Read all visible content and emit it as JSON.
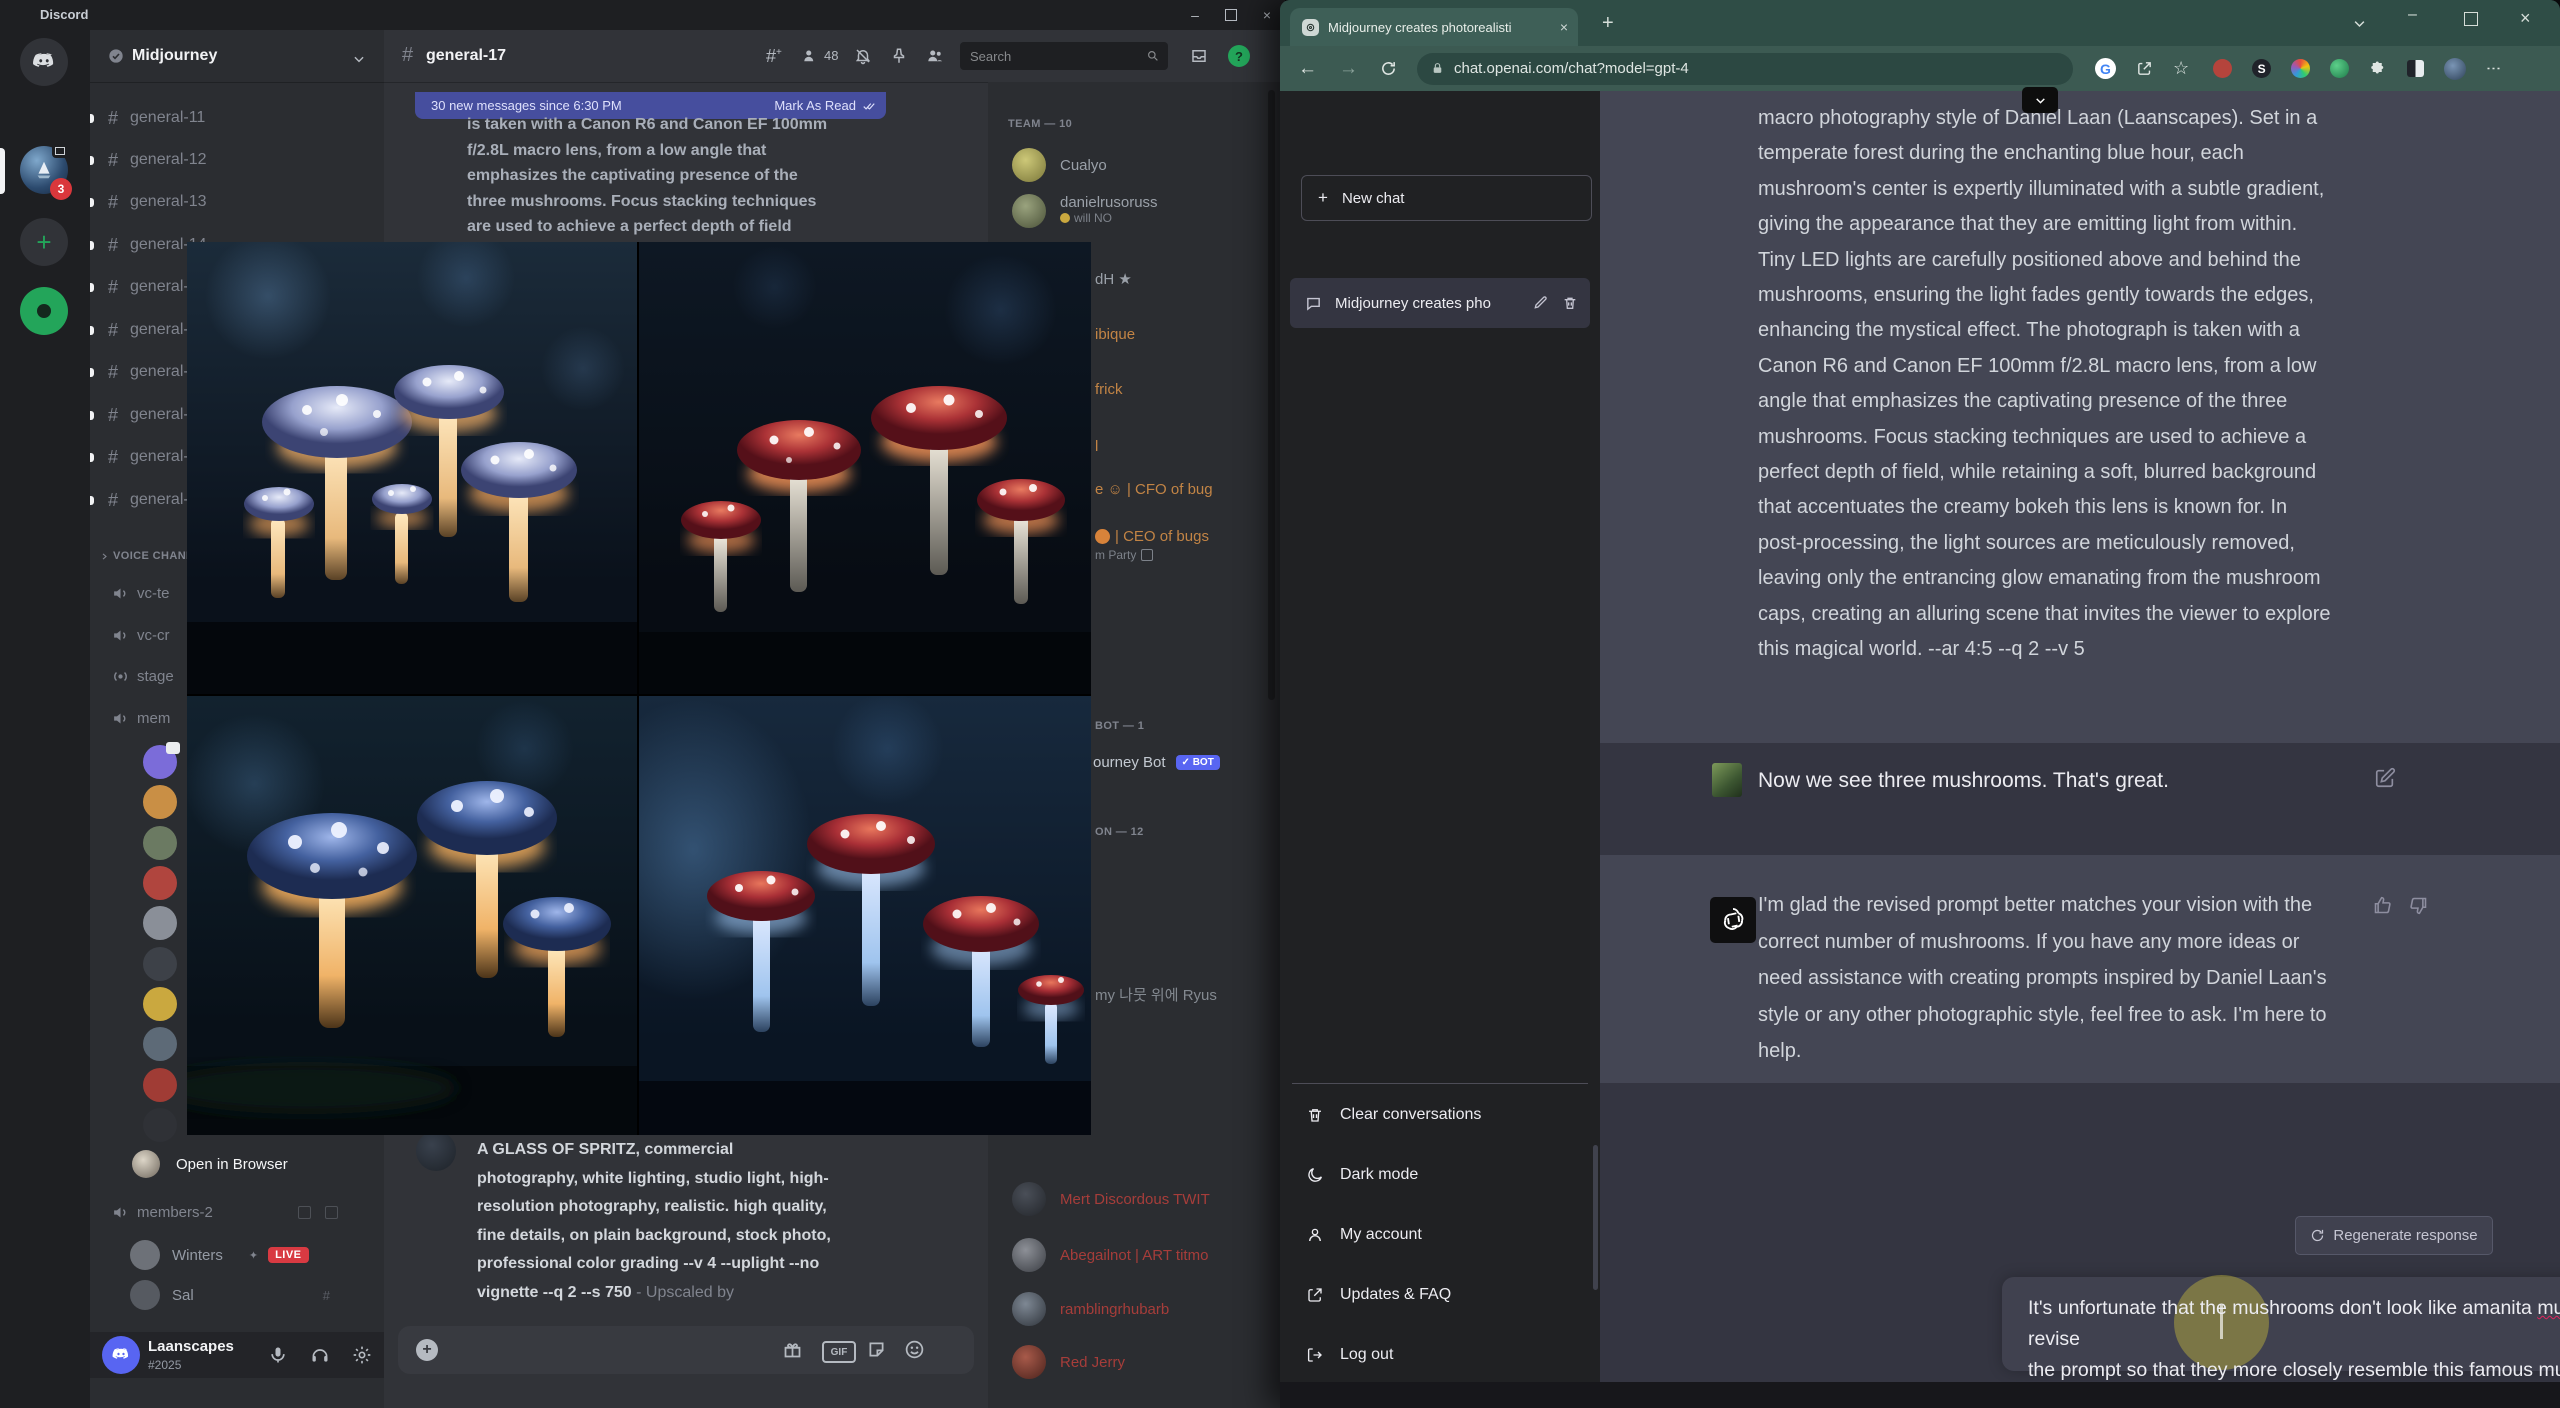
{
  "discord": {
    "title": "Discord",
    "server": "Midjourney",
    "channels": [
      "general-11",
      "general-12",
      "general-13",
      "general-14",
      "general-15",
      "general-16",
      "general-17",
      "general-18",
      "general-19",
      "general-20"
    ],
    "voice_category": "VOICE CHANNELS",
    "voice_channels": [
      "vc-te",
      "vc-cr",
      "stage",
      "mem"
    ],
    "open_in_browser": "Open in Browser",
    "members2": "members-2",
    "winters": "Winters",
    "live_badge": "LIVE",
    "sal": "Sal",
    "user": {
      "name": "Laanscapes",
      "tag": "#2025"
    },
    "topbar": {
      "channel": "general-17",
      "count": "48",
      "search": "Search"
    },
    "banner": {
      "text": "30 new messages since 6:30 PM",
      "action": "Mark As Read"
    },
    "top_message": [
      "is taken with a Canon R6 and Canon EF 100mm",
      "f/2.8L macro lens, from a low angle that",
      "emphasizes the captivating presence of the",
      "three mushrooms. Focus stacking techniques",
      "are used to achieve a perfect depth of field"
    ],
    "bottom_message": {
      "bold": [
        "A GLASS OF SPRITZ, commercial",
        "photography, white lighting, studio light, high-",
        "resolution photography, realistic. high quality,",
        "fine details, on plain background, stock photo,",
        "professional color grading --v 4 --uplight --no",
        "vignette --q 2 --s 750"
      ],
      "suffix": " - Upscaled by"
    },
    "member_list": {
      "team_header": "TEAM — 10",
      "m1": "Cualyo",
      "m2": "danielrusoruss",
      "m2_sub": "will NO",
      "m3": "dH ★",
      "m4": "ibique",
      "m5": "frick",
      "m6": "l",
      "m7": "e ☺ | CFO of bug",
      "m8": "| CEO of bugs",
      "m8_sub": "m Party",
      "bot_header": "BOT — 1",
      "bot_name": "ourney Bot",
      "bot_badge": "✓ BOT",
      "section2": "ON — 12",
      "m9": "my 나뭇 위에 Ryus",
      "m10": "Mert Discordous TWIT",
      "m11": "Abegailnot | ART titmo",
      "m12": "ramblingrhubarb",
      "m13": "Red Jerry"
    }
  },
  "browser": {
    "tab_title": "Midjourney creates photorealisti",
    "url": "chat.openai.com/chat?model=gpt-4",
    "sidebar": {
      "new_chat": "New chat",
      "conversation": "Midjourney creates pho",
      "menu": [
        "Clear conversations",
        "Dark mode",
        "My account",
        "Updates & FAQ",
        "Log out"
      ]
    },
    "chat": {
      "assistant1": [
        "macro photography style of Daniel Laan (Laanscapes). Set in a",
        "temperate forest during the enchanting blue hour, each",
        "mushroom's center is expertly illuminated with a subtle gradient,",
        "giving the appearance that they are emitting light from within.",
        "Tiny LED lights are carefully positioned above and behind the",
        "mushrooms, ensuring the light fades gently towards the edges,",
        "enhancing the mystical effect. The photograph is taken with a",
        "Canon R6 and Canon EF 100mm f/2.8L macro lens, from a low",
        "angle that emphasizes the captivating presence of the three",
        "mushrooms. Focus stacking techniques are used to achieve a",
        "perfect depth of field, while retaining a soft, blurred background",
        "that accentuates the creamy bokeh this lens is known for. In",
        "post-processing, the light sources are meticulously removed,",
        "leaving only the entrancing glow emanating from the mushroom",
        "caps, creating an alluring scene that invites the viewer to explore",
        "this magical world. --ar 4:5 --q 2 --v 5"
      ],
      "user1": "Now we see three mushrooms. That's great.",
      "assistant2": [
        "I'm glad the revised prompt better matches your vision with the",
        "correct number of mushrooms. If you have any more ideas or",
        "need assistance with creating prompts inspired by Daniel Laan's",
        "style or any other photographic style, feel free to ask. I'm here to",
        "help."
      ],
      "regenerate": "Regenerate response",
      "input": {
        "seg1": "It's unfortunate that the mushrooms don't look like amanita ",
        "misspelled": "muscaria",
        "seg2": ". could you revise",
        "seg3": "the prompt so that they more closely resemble this famous mushroom? M"
      }
    }
  },
  "colors": {
    "discord_accent": "#5865f2",
    "live_red": "#d83a42",
    "chrome_theme": "#3c5a52",
    "assistant_row": "#444654"
  }
}
